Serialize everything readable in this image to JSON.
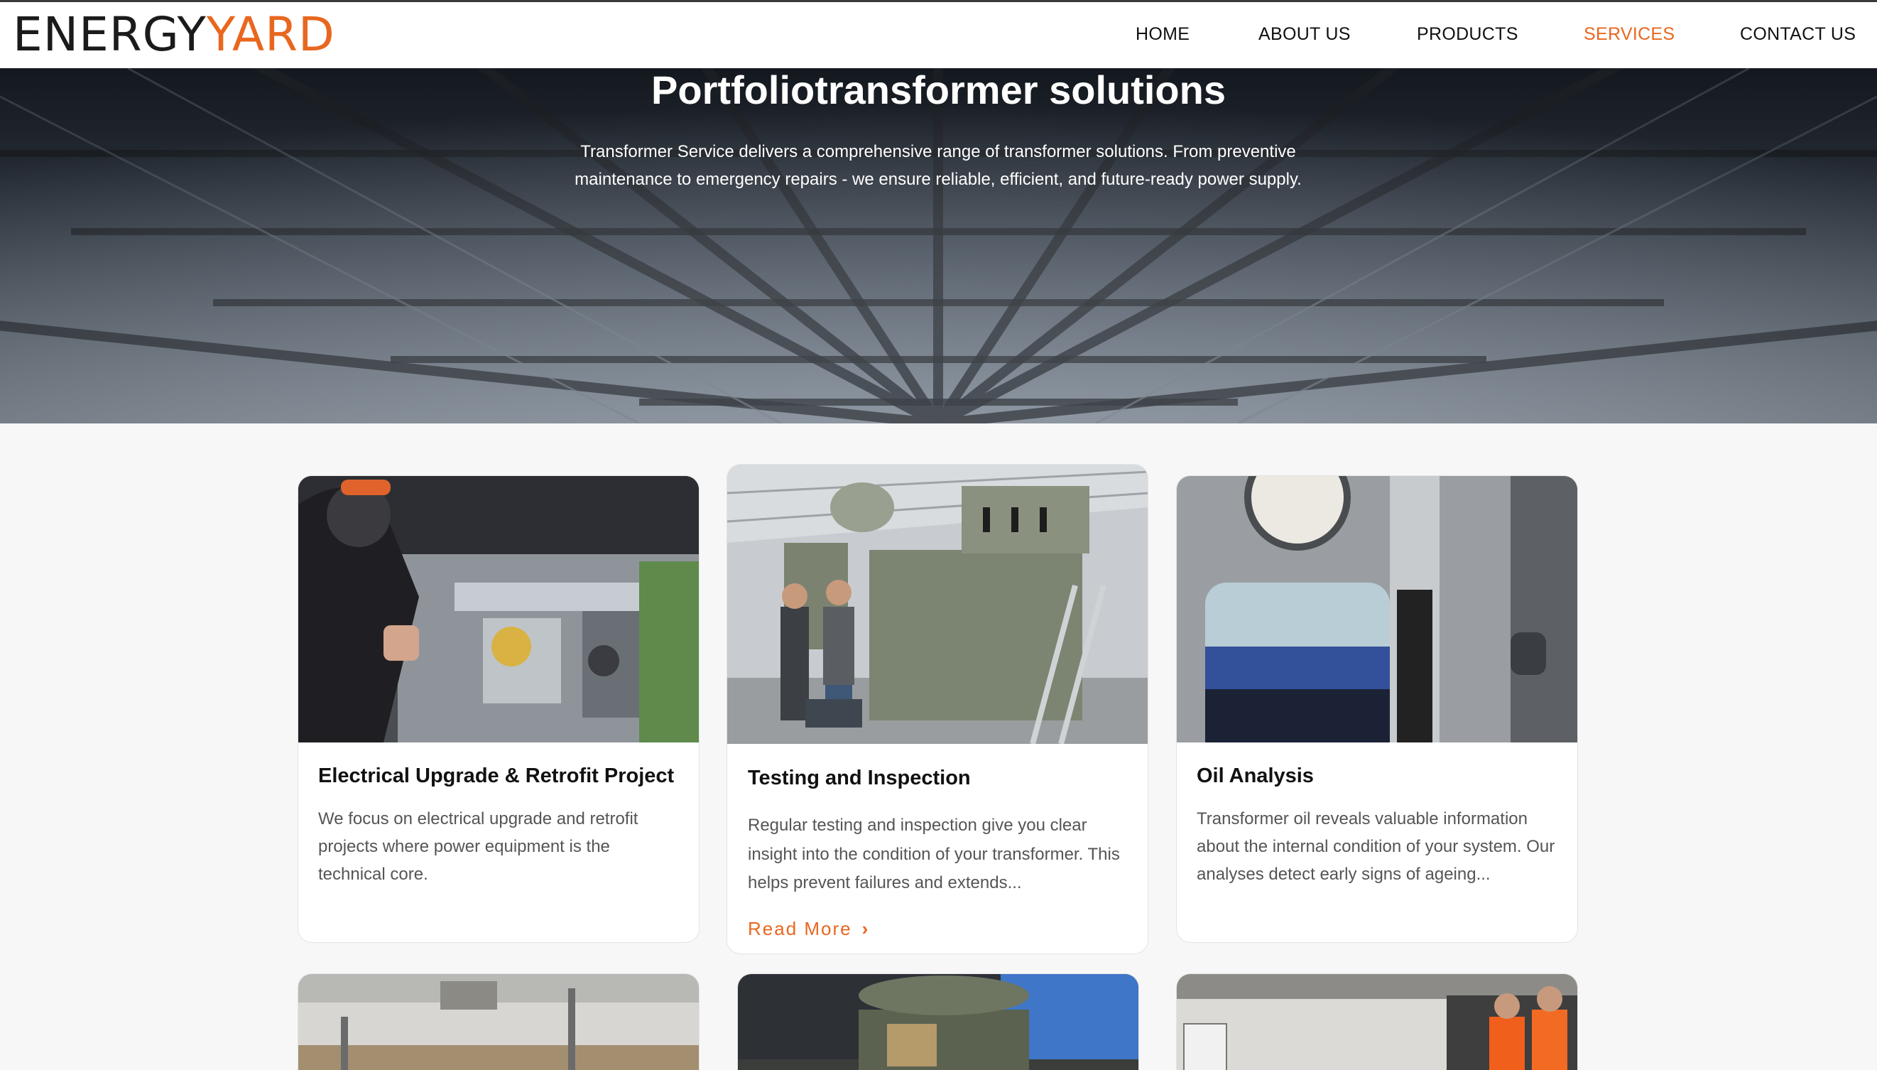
{
  "header": {
    "logo_part1": "ENERGY",
    "logo_part2": "ARD",
    "nav": {
      "home": "HOME",
      "about": "ABOUT US",
      "products": "PRODUCTS",
      "services": "SERVICES",
      "contact": "CONTACT US"
    },
    "active_nav": "SERVICES",
    "accent_color": "#e8671f"
  },
  "hero": {
    "title": "Portfoliotransformer solutions",
    "text_line1": "Transformer Service delivers a comprehensive range of transformer solutions. From preventive",
    "text_line2": "maintenance to emergency repairs - we ensure reliable, efficient, and future-ready power supply."
  },
  "cards": [
    {
      "title": "Electrical Upgrade & Retrofit Project",
      "text": "We focus on electrical upgrade and retrofit projects where power equipment is the technical core."
    },
    {
      "title": "Testing and  Inspection",
      "text": "Regular testing and inspection give you clear insight into the condition of your transformer. This helps prevent failures and extends...",
      "link": "Read More",
      "link_icon": "chevron-right-icon"
    },
    {
      "title": "Oil Analysis",
      "text": "Transformer oil reveals valuable information about the internal condition of your system. Our analyses detect early signs of ageing..."
    }
  ]
}
